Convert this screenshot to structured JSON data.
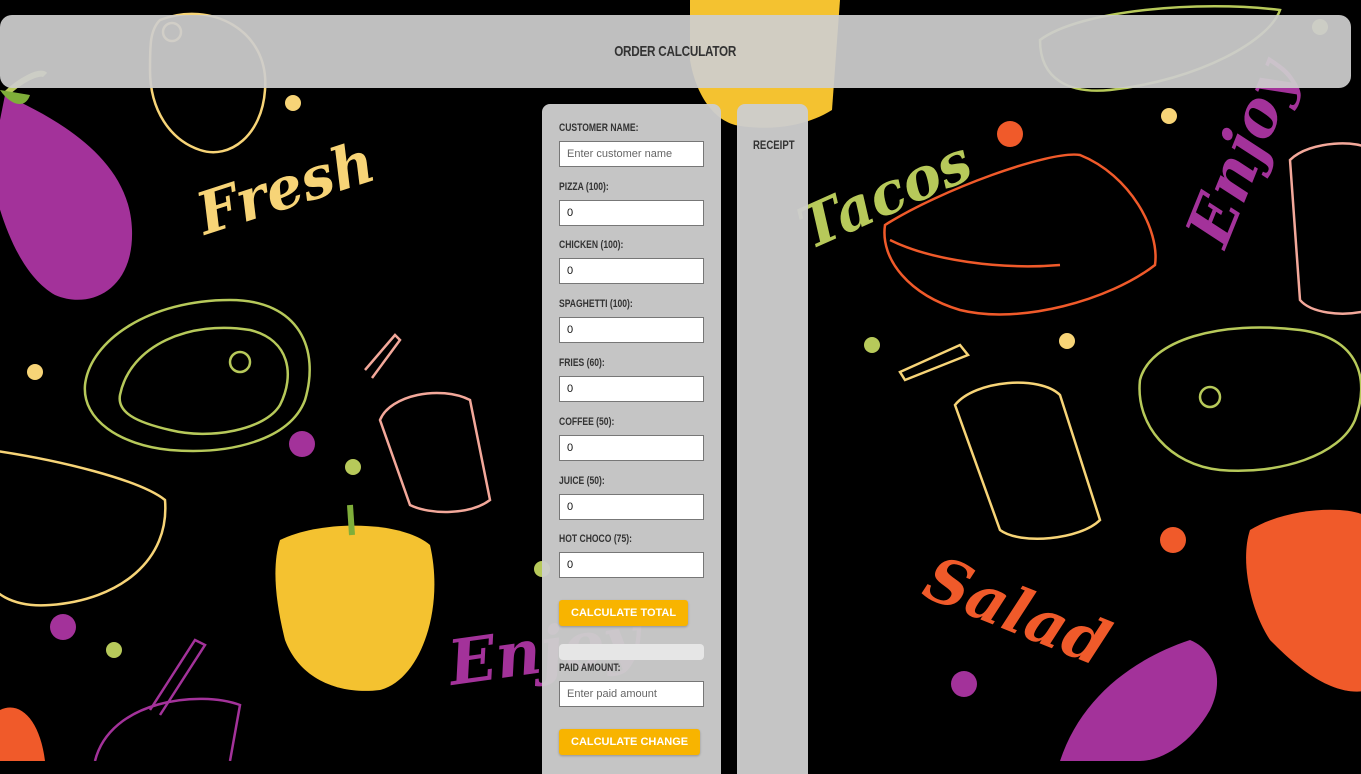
{
  "header": {
    "title": "ORDER CALCULATOR"
  },
  "form": {
    "customer": {
      "label": "CUSTOMER NAME:",
      "value": "",
      "placeholder": "Enter customer name"
    },
    "items": [
      {
        "label": "PIZZA (100):",
        "value": "0"
      },
      {
        "label": "CHICKEN (100):",
        "value": "0"
      },
      {
        "label": "SPAGHETTI (100):",
        "value": "0"
      },
      {
        "label": "FRIES (60):",
        "value": "0"
      },
      {
        "label": "COFFEE (50):",
        "value": "0"
      },
      {
        "label": "JUICE (50):",
        "value": "0"
      },
      {
        "label": "HOT CHOCO (75):",
        "value": "0"
      }
    ],
    "calculate_total_label": "CALCULATE TOTAL",
    "total_value": "",
    "paid": {
      "label": "PAID AMOUNT:",
      "value": "",
      "placeholder": "Enter paid amount"
    },
    "calculate_change_label": "CALCULATE CHANGE"
  },
  "receipt": {
    "title": "RECEIPT"
  },
  "background": {
    "words": [
      "Fresh",
      "Tacos",
      "Enjoy",
      "Salad",
      "Enjoy"
    ],
    "colors": {
      "purple": "#a3329a",
      "yellow": "#f7d477",
      "green": "#b7c95a",
      "orange": "#f05a2a",
      "pink": "#f3a89a"
    }
  },
  "colors": {
    "panel": "#cdcdcd",
    "button": "#f8b400",
    "button_text": "#ffffff"
  }
}
